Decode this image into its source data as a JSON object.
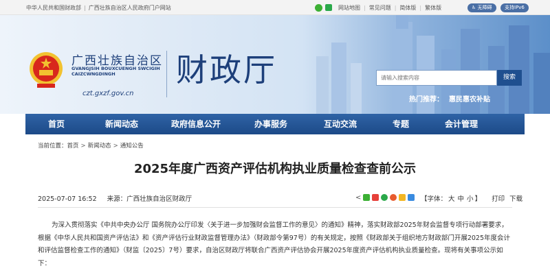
{
  "topbar": {
    "links_left": [
      "中华人民共和国财政部",
      "广西壮族自治区人民政府门户网站"
    ],
    "links_right": [
      "网站地图",
      "常见问题",
      "简体版",
      "繁体版"
    ],
    "badge_accessible": "无障碍",
    "badge_ipv6": "支持IPv6"
  },
  "header": {
    "region_name": "广西壮族自治区",
    "region_zhuang": [
      "GVANGJSIH BOUXCUENGH SWCIGIH",
      "CAIZCWNGDINGH"
    ],
    "domain": "czt.gxzf.gov.cn",
    "dept_name": "财政厅",
    "search_placeholder": "请输入搜索内容",
    "search_button": "搜索",
    "hot_label": "热门推荐：",
    "hot_item": "惠民惠农补贴"
  },
  "nav": [
    "首页",
    "新闻动态",
    "政府信息公开",
    "办事服务",
    "互动交流",
    "专题",
    "会计管理"
  ],
  "breadcrumb": {
    "prefix": "当前位置：",
    "items": [
      "首页",
      "新闻动态",
      "通知公告"
    ]
  },
  "article": {
    "title": "2025年度广西资产评估机构执业质量检查查前公示",
    "date": "2025-07-07 16:52",
    "source_label": "来源：",
    "source": "广西壮族自治区财政厅",
    "font_label": "【字体：",
    "font_sizes": [
      "大",
      "中",
      "小"
    ],
    "font_close": "】",
    "print": "打印",
    "download": "下载",
    "body": "为深入贯彻落实《中共中央办公厅 国务院办公厅印发〈关于进一步加强财会监督工作的意见〉的通知》精神，落实财政部2025年财会监督专项行动部署要求，根据《中华人民共和国资产评估法》和《资产评估行业财政监督管理办法》（财政部令第97号）的有关规定，按照《财政部关于组织地方财政部门开展2025年度会计和评估监督检查工作的通知》（财监〔2025〕7号）要求，自治区财政厅将联合广西资产评估协会开展2025年度资产评估机构执业质量检查。现将有关事项公示如下："
  },
  "colors": {
    "nav_bg": "#1c4a88",
    "title_text": "#222222",
    "brand_blue": "#1d3f7a"
  }
}
